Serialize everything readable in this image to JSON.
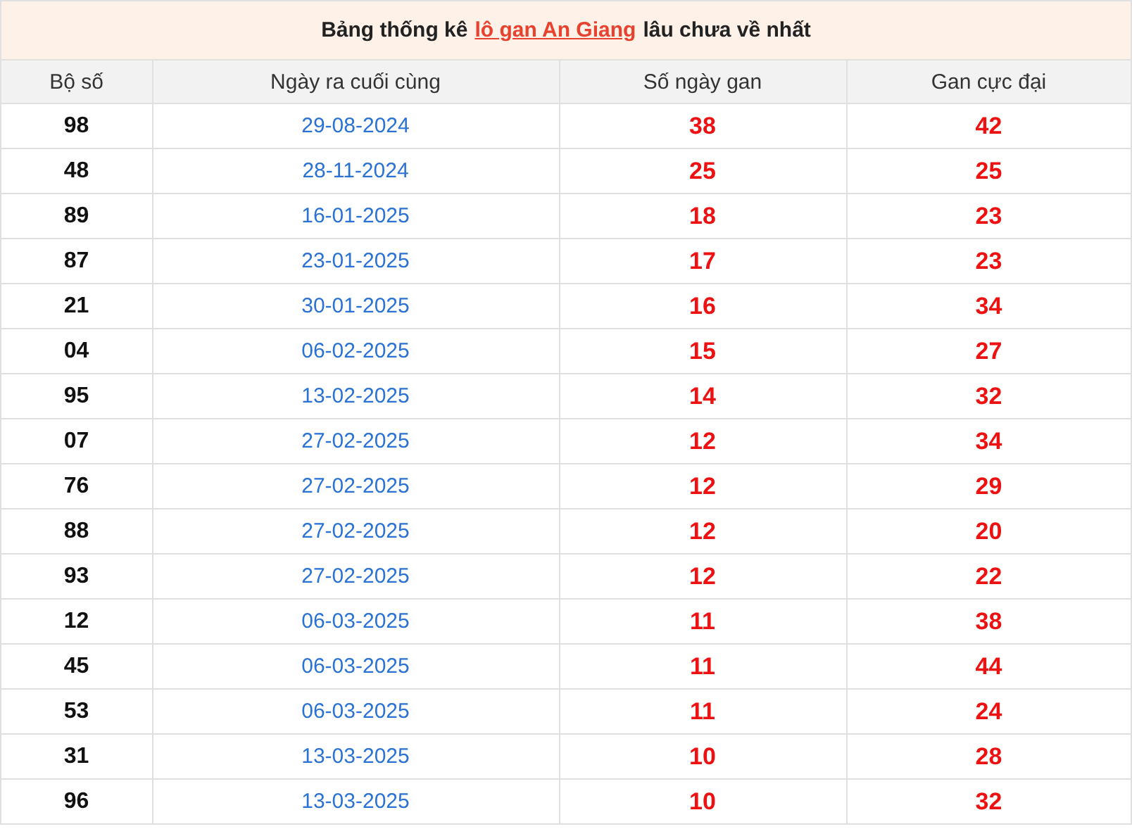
{
  "title": {
    "before": "Bảng thống kê",
    "link": "lô gan An Giang",
    "after": "lâu chưa về nhất"
  },
  "table": {
    "columns": [
      "Bộ số",
      "Ngày ra cuối cùng",
      "Số ngày gan",
      "Gan cực đại"
    ],
    "rows": [
      [
        "98",
        "29-08-2024",
        "38",
        "42"
      ],
      [
        "48",
        "28-11-2024",
        "25",
        "25"
      ],
      [
        "89",
        "16-01-2025",
        "18",
        "23"
      ],
      [
        "87",
        "23-01-2025",
        "17",
        "23"
      ],
      [
        "21",
        "30-01-2025",
        "16",
        "34"
      ],
      [
        "04",
        "06-02-2025",
        "15",
        "27"
      ],
      [
        "95",
        "13-02-2025",
        "14",
        "32"
      ],
      [
        "07",
        "27-02-2025",
        "12",
        "34"
      ],
      [
        "76",
        "27-02-2025",
        "12",
        "29"
      ],
      [
        "88",
        "27-02-2025",
        "12",
        "20"
      ],
      [
        "93",
        "27-02-2025",
        "12",
        "22"
      ],
      [
        "12",
        "06-03-2025",
        "11",
        "38"
      ],
      [
        "45",
        "06-03-2025",
        "11",
        "44"
      ],
      [
        "53",
        "06-03-2025",
        "11",
        "24"
      ],
      [
        "31",
        "13-03-2025",
        "10",
        "28"
      ],
      [
        "96",
        "13-03-2025",
        "10",
        "32"
      ]
    ]
  }
}
